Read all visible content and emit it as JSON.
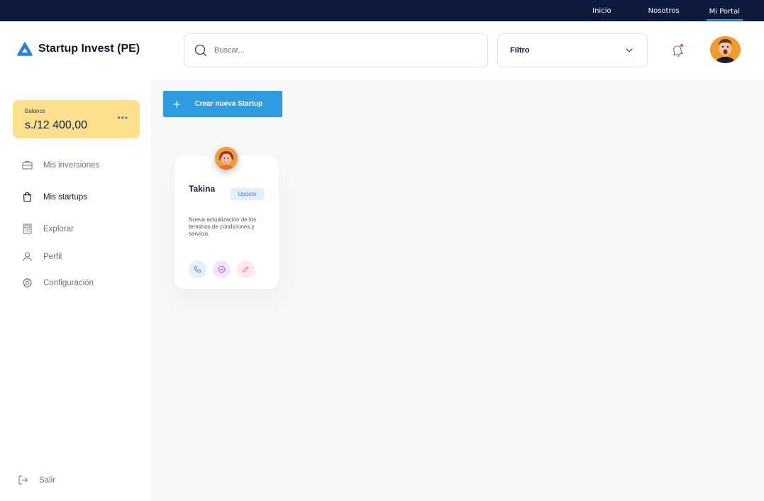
{
  "topnav": {
    "items": [
      "Inicio",
      "Nosotros",
      "Mi Portal"
    ],
    "active": "Mi Portal"
  },
  "header": {
    "app_title": "Startup Invest (PE)",
    "search_placeholder": "Buscar...",
    "filter_label": "Filtro"
  },
  "sidebar": {
    "balance_label": "Balance",
    "balance_amount": "s./12 400,00",
    "items": [
      {
        "label": "Mis inversiones",
        "icon": "briefcase-icon"
      },
      {
        "label": "Mis startups",
        "icon": "shopping-bag-icon"
      },
      {
        "label": "Explorar",
        "icon": "calculator-icon"
      },
      {
        "label": "Perfil",
        "icon": "user-icon"
      },
      {
        "label": "Configuración",
        "icon": "gear-icon"
      }
    ],
    "logout_label": "Salir"
  },
  "main": {
    "create_button_label": "Crear nueva Startup",
    "card": {
      "name": "Takina",
      "badge": "Update",
      "description": "Nueva actualización de los terminos de condiciones y servicio."
    }
  },
  "colors": {
    "topbar": "#0d1a3d",
    "accent": "#2f9be0",
    "balance_bg": "#fde08c",
    "active_underline": "#22a8d8"
  }
}
